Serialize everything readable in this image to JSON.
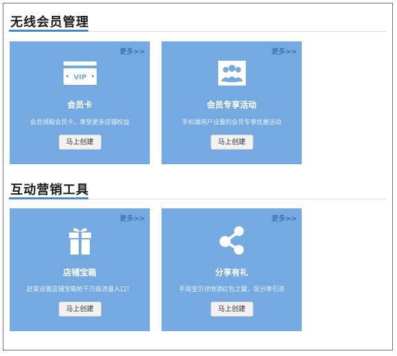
{
  "sections": [
    {
      "title": "无线会员管理",
      "cards": [
        {
          "more": "更多>>",
          "icon_text": "VIP",
          "icon": "vip-card-icon",
          "title": "会员卡",
          "desc": "会员领取会员卡，享受更多店铺权益",
          "button": "马上创建"
        },
        {
          "more": "更多>>",
          "icon": "members-group-icon",
          "title": "会员专享活动",
          "desc": "手机端用户设置的会员专享优惠活动",
          "button": "马上创建"
        }
      ]
    },
    {
      "title": "互动营销工具",
      "cards": [
        {
          "more": "更多>>",
          "icon": "gift-box-icon",
          "title": "店铺宝箱",
          "desc": "赶紧设置店铺宝箱抢千万级流量入口！",
          "button": "马上创建"
        },
        {
          "more": "更多>>",
          "icon": "share-icon",
          "title": "分享有礼",
          "desc": "手淘宝贝详情添红包之翼，促分享引流",
          "button": "马上创建"
        }
      ]
    }
  ],
  "colors": {
    "card_bg": "#74a9e1",
    "accent": "#4a86c8",
    "more_link": "#245c9c"
  }
}
